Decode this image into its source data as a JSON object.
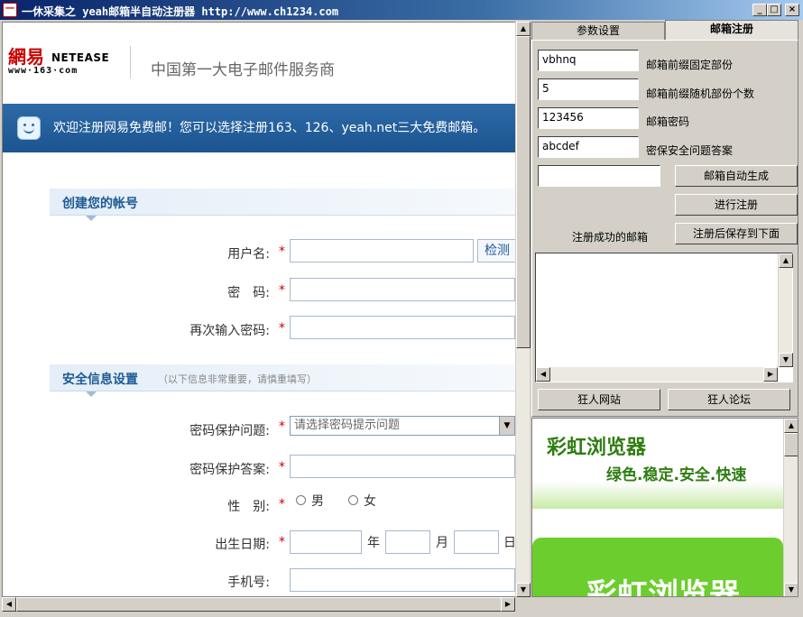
{
  "window": {
    "icon_text": "一",
    "title": "一休采集之 yeah邮箱半自动注册器   http://www.ch1234.com",
    "btn_min": "_",
    "btn_max": "□",
    "btn_close": "×"
  },
  "web": {
    "logo_cn": "網易",
    "logo_en": "NETEASE",
    "logo_url": "www·163·com",
    "slogan": "中国第一大电子邮件服务商",
    "banner": "欢迎注册网易免费邮！您可以选择注册163、126、yeah.net三大免费邮箱。",
    "section_account": "创建您的帐号",
    "username_label": "用户名:",
    "password_label": "密　码:",
    "confirm_label": "再次输入密码:",
    "detect_button": "检测",
    "section_security": "安全信息设置",
    "security_note": "（以下信息非常重要，请慎重填写）",
    "question_label": "密码保护问题:",
    "question_placeholder": "请选择密码提示问题",
    "answer_label": "密码保护答案:",
    "gender_label": "性　别:",
    "male": "男",
    "female": "女",
    "birthday_label": "出生日期:",
    "year": "年",
    "month": "月",
    "day": "日",
    "phone_label": "手机号:",
    "required_mark": "*"
  },
  "scroll": {
    "up": "▲",
    "down": "▼",
    "left": "◀",
    "right": "▶"
  },
  "panel": {
    "tabs": [
      "参数设置",
      "邮箱注册"
    ],
    "fields": [
      {
        "value": "vbhnq",
        "label": "邮箱前缀固定部份"
      },
      {
        "value": "5",
        "label": "邮箱前缀随机部份个数"
      },
      {
        "value": "123456",
        "label": "邮箱密码"
      },
      {
        "value": "abcdef",
        "label": "密保安全问题答案"
      }
    ],
    "generated_value": "",
    "auto_generate": "邮箱自动生成",
    "register": "进行注册",
    "success_label": "注册成功的邮箱",
    "save_after": "注册后保存到下面",
    "site_button": "狂人网站",
    "forum_button": "狂人论坛"
  },
  "ad": {
    "title": "彩虹浏览器",
    "tagline": "绿色.稳定.安全.快速",
    "big": "彩虹浏览器"
  }
}
